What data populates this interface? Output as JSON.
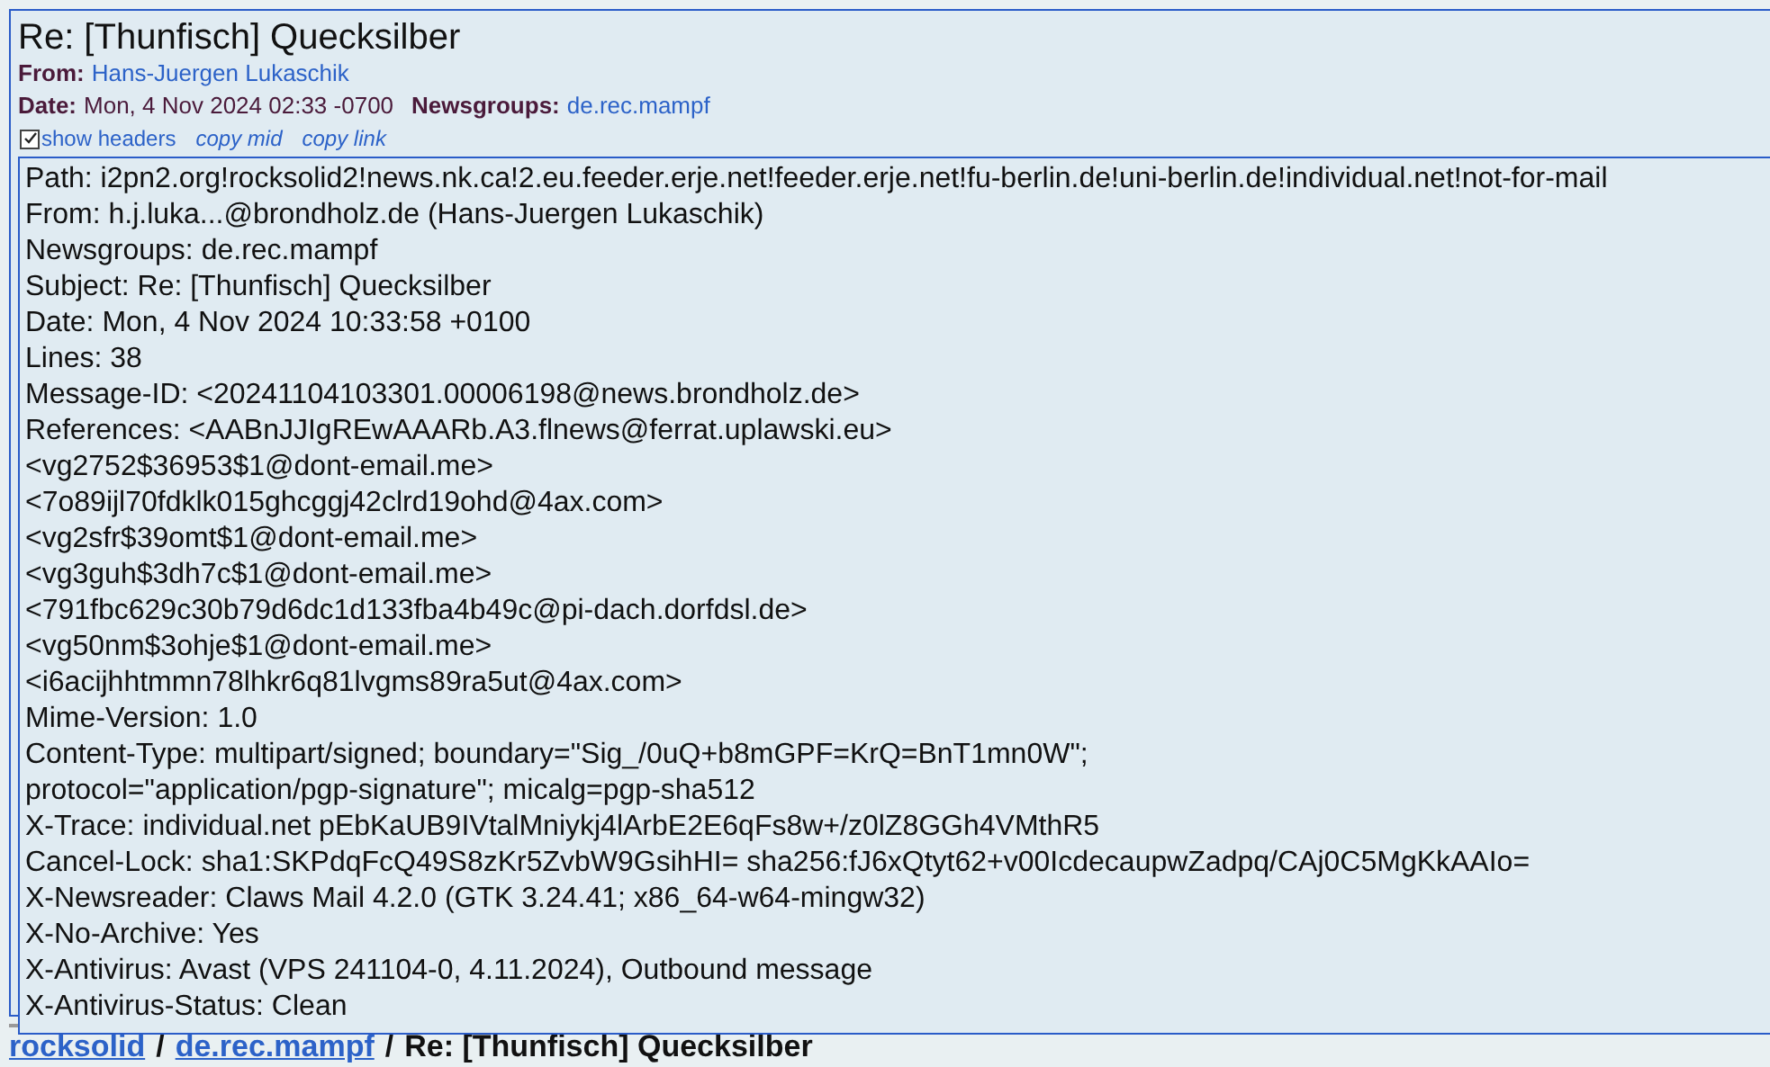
{
  "article": {
    "subject": "Re: [Thunfisch] Quecksilber",
    "from_label": "From:",
    "from": "Hans-Juergen Lukaschik",
    "date_label": "Date:",
    "date": "Mon, 4 Nov 2024 02:33 -0700",
    "newsgroups_label": "Newsgroups:",
    "newsgroups": "de.rec.mampf",
    "show_headers": {
      "label": "show headers",
      "checked": true
    },
    "links": [
      "copy mid",
      "copy link"
    ],
    "headers": [
      "Path: i2pn2.org!rocksolid2!news.nk.ca!2.eu.feeder.erje.net!feeder.erje.net!fu-berlin.de!uni-berlin.de!individual.net!not-for-mail",
      "From: h.j.luka...@brondholz.de (Hans-Juergen Lukaschik)",
      "Newsgroups: de.rec.mampf",
      "Subject: Re: [Thunfisch] Quecksilber",
      "Date: Mon, 4 Nov 2024 10:33:58 +0100",
      "Lines: 38",
      "Message-ID: <20241104103301.00006198@news.brondholz.de>",
      "References: <AABnJJIgREwAAARb.A3.flnews@ferrat.uplawski.eu>",
      "<vg2752$36953$1@dont-email.me>",
      "<7o89ijl70fdklk015ghcggj42clrd19ohd@4ax.com>",
      "<vg2sfr$39omt$1@dont-email.me>",
      "<vg3guh$3dh7c$1@dont-email.me>",
      "<791fbc629c30b79d6dc1d133fba4b49c@pi-dach.dorfdsl.de>",
      "<vg50nm$3ohje$1@dont-email.me>",
      "<i6acijhhtmmn78lhkr6q81lvgms89ra5ut@4ax.com>",
      "Mime-Version: 1.0",
      "Content-Type: multipart/signed; boundary=\"Sig_/0uQ+b8mGPF=KrQ=BnT1mn0W\";",
      "protocol=\"application/pgp-signature\"; micalg=pgp-sha512",
      "X-Trace: individual.net pEbKaUB9IVtalMniykj4lArbE2E6qFs8w+/z0lZ8GGh4VMthR5",
      "Cancel-Lock: sha1:SKPdqFcQ49S8zKr5ZvbW9GsihHI= sha256:fJ6xQtyt62+v00IcdecaupwZadpq/CAj0C5MgKkAAIo=",
      "X-Newsreader: Claws Mail 4.2.0 (GTK 3.24.41; x86_64-w64-mingw32)",
      "X-No-Archive: Yes",
      "X-Antivirus: Avast (VPS 241104-0, 4.11.2024), Outbound message",
      "X-Antivirus-Status: Clean"
    ]
  },
  "breadcrumb": [
    {
      "label": "rocksolid",
      "kind": "link"
    },
    {
      "label": "/",
      "kind": "sep"
    },
    {
      "label": "de.rec.mampf",
      "kind": "link"
    },
    {
      "label": "/",
      "kind": "sep"
    },
    {
      "label": "Re: [Thunfisch] Quecksilber",
      "kind": "current"
    }
  ]
}
